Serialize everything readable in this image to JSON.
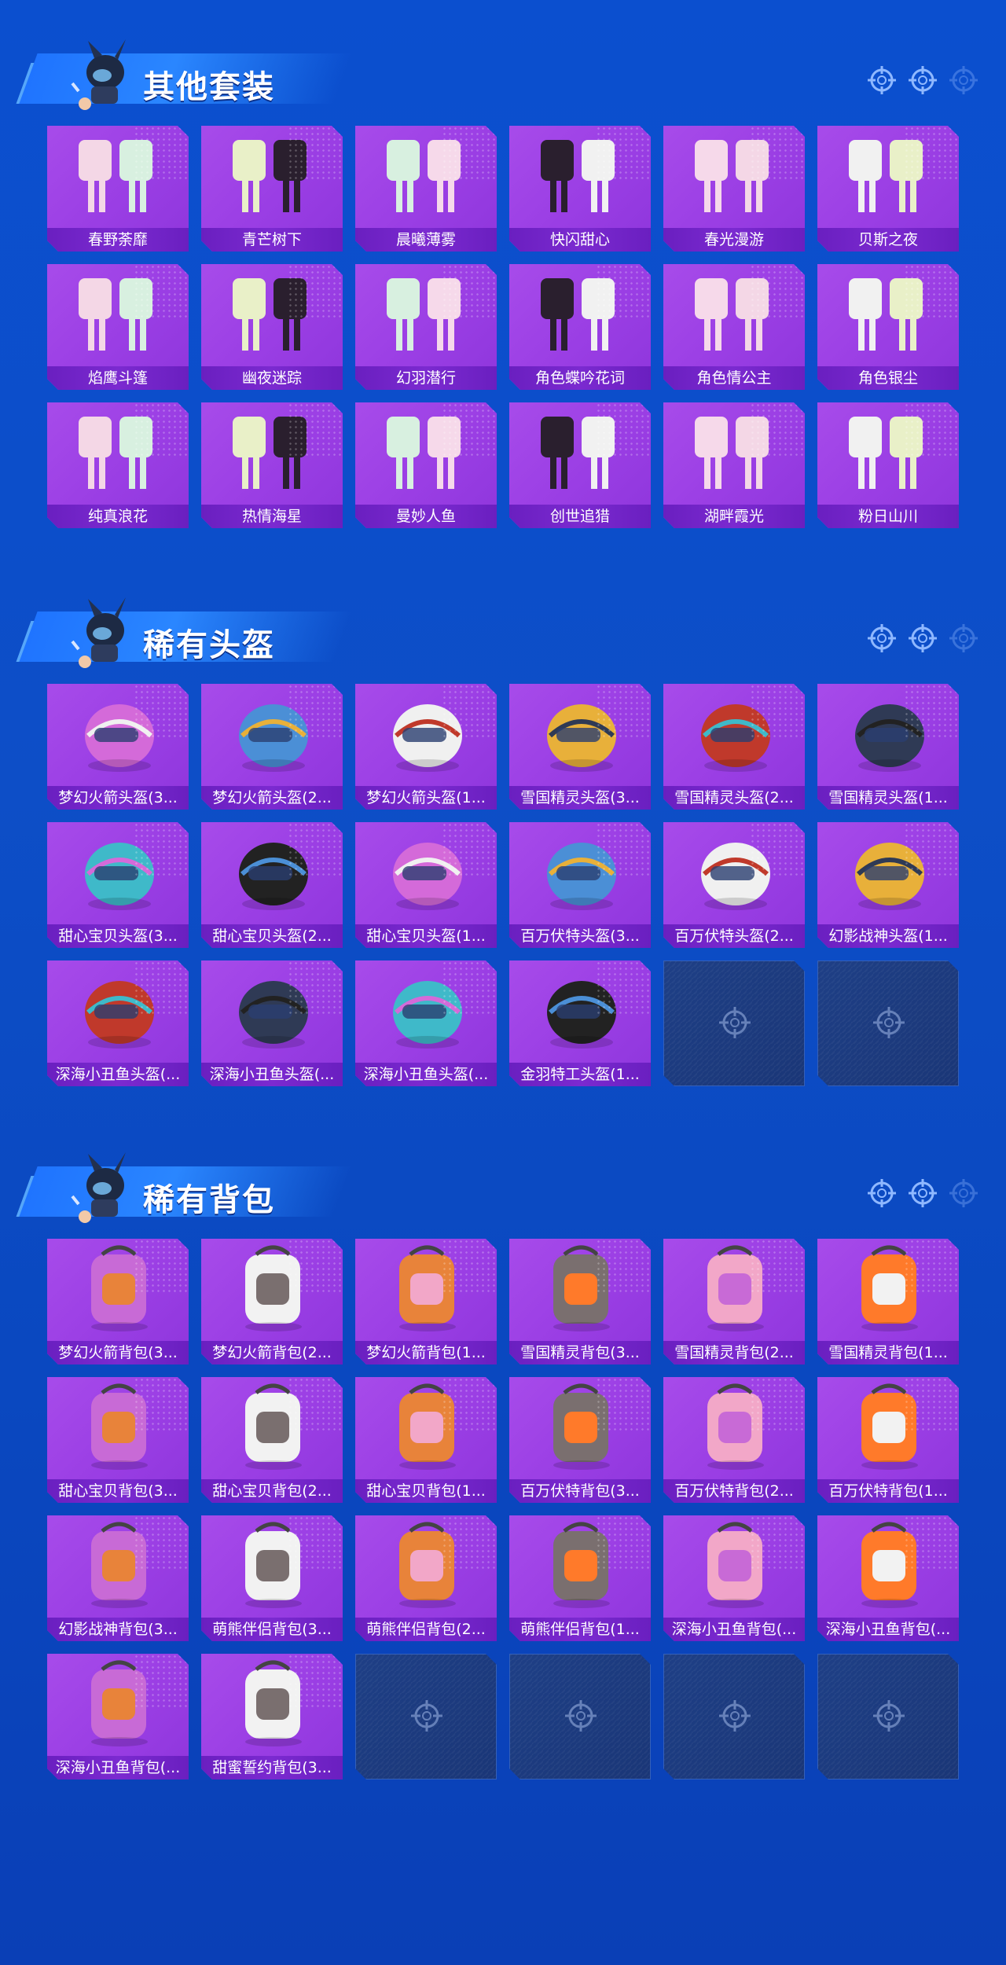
{
  "sections": [
    {
      "title": "其他套装",
      "items": [
        "春野荼靡",
        "青芒树下",
        "晨曦薄雾",
        "快闪甜心",
        "春光漫游",
        "贝斯之夜",
        "焰鹰斗篷",
        "幽夜迷踪",
        "幻羽潜行",
        "角色蝶吟花词",
        "角色情公主",
        "角色银尘",
        "纯真浪花",
        "热情海星",
        "曼妙人鱼",
        "创世追猎",
        "湖畔霞光",
        "粉日山川"
      ],
      "empty_slots": 0
    },
    {
      "title": "稀有头盔",
      "items": [
        "梦幻火箭头盔(3...",
        "梦幻火箭头盔(2...",
        "梦幻火箭头盔(1...",
        "雪国精灵头盔(3...",
        "雪国精灵头盔(2...",
        "雪国精灵头盔(1...",
        "甜心宝贝头盔(3...",
        "甜心宝贝头盔(2...",
        "甜心宝贝头盔(1...",
        "百万伏特头盔(3...",
        "百万伏特头盔(2...",
        "幻影战神头盔(1...",
        "深海小丑鱼头盔(...",
        "深海小丑鱼头盔(...",
        "深海小丑鱼头盔(...",
        "金羽特工头盔(1..."
      ],
      "empty_slots": 2
    },
    {
      "title": "稀有背包",
      "items": [
        "梦幻火箭背包(3...",
        "梦幻火箭背包(2...",
        "梦幻火箭背包(1...",
        "雪国精灵背包(3...",
        "雪国精灵背包(2...",
        "雪国精灵背包(1...",
        "甜心宝贝背包(3...",
        "甜心宝贝背包(2...",
        "甜心宝贝背包(1...",
        "百万伏特背包(3...",
        "百万伏特背包(2...",
        "百万伏特背包(1...",
        "幻影战神背包(3...",
        "萌熊伴侣背包(3...",
        "萌熊伴侣背包(2...",
        "萌熊伴侣背包(1...",
        "深海小丑鱼背包(...",
        "深海小丑鱼背包(...",
        "深海小丑鱼背包(...",
        "甜蜜誓约背包(3..."
      ],
      "empty_slots": 4
    }
  ],
  "icons": {
    "header_mascot": "mascot-icon",
    "header_decor": "crosshair-icon",
    "empty_slot": "crosshair-icon"
  },
  "colors": {
    "background": "#0b4fcf",
    "card": "#a74bea",
    "label_bar": "#6a1fc0",
    "empty_card": "#1e3f86"
  }
}
